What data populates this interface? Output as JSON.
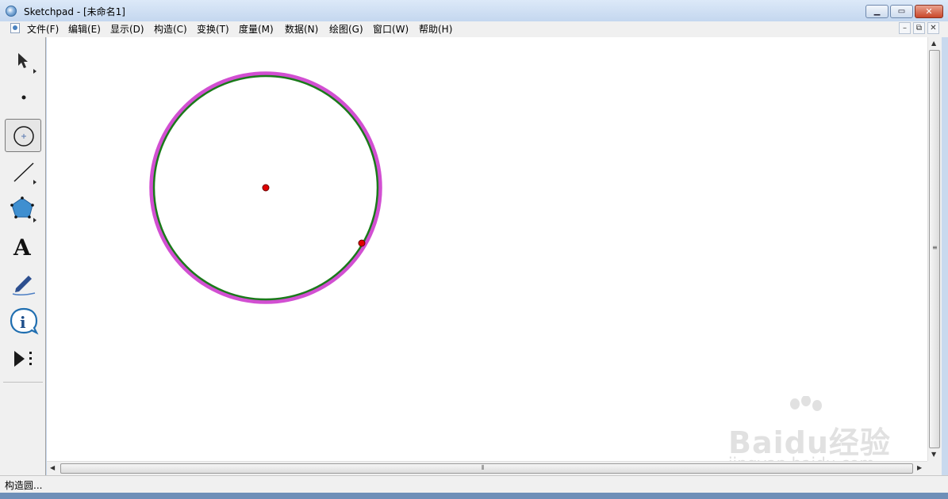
{
  "window": {
    "title": "Sketchpad  - [未命名1]",
    "minimize_icon": "minimize-icon",
    "maximize_icon": "restore-icon",
    "close_icon": "close-icon"
  },
  "menu": {
    "items": [
      {
        "label": "文件(F)"
      },
      {
        "label": "编辑(E)"
      },
      {
        "label": "显示(D)"
      },
      {
        "label": "构造(C)"
      },
      {
        "label": "变换(T)"
      },
      {
        "label": "度量(M)"
      },
      {
        "label": "数据(N)"
      },
      {
        "label": "绘图(G)"
      },
      {
        "label": "窗口(W)"
      },
      {
        "label": "帮助(H)"
      }
    ]
  },
  "toolbox": {
    "tools": [
      {
        "name": "arrow-select-tool",
        "icon": "pointer-arrow-icon"
      },
      {
        "name": "point-tool",
        "icon": "point-icon"
      },
      {
        "name": "compass-tool",
        "icon": "circle-compass-icon",
        "selected": true
      },
      {
        "name": "straightedge-tool",
        "icon": "line-segment-icon"
      },
      {
        "name": "polygon-tool",
        "icon": "pentagon-icon"
      },
      {
        "name": "text-tool",
        "icon": "text-A-icon",
        "glyph": "A"
      },
      {
        "name": "marker-tool",
        "icon": "pen-marker-icon"
      },
      {
        "name": "information-tool",
        "icon": "info-icon",
        "glyph": "i"
      },
      {
        "name": "custom-tool",
        "icon": "play-more-icon"
      }
    ]
  },
  "sketch": {
    "circle_color": "#1a7a1a",
    "highlight_color": "#d24fd2",
    "point_color": "#e00000"
  },
  "status": {
    "text": "构造圆..."
  },
  "watermark": {
    "brand": "Baidu经验",
    "url": "jingyan.baidu.com"
  }
}
